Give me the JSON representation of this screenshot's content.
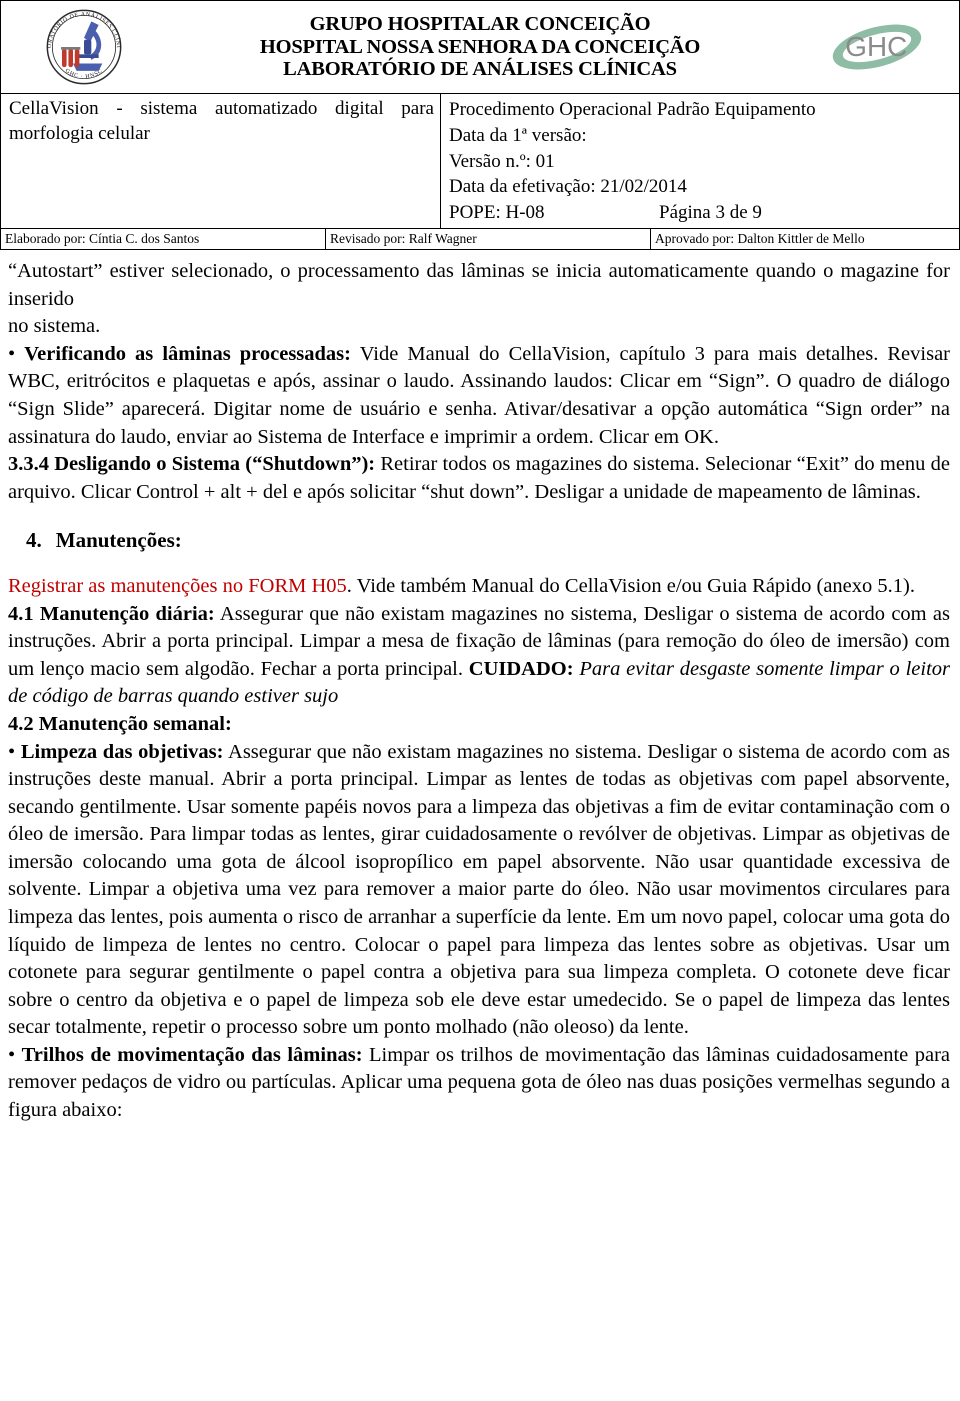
{
  "header": {
    "left_logo": {
      "name": "laboratory-seal-logo",
      "ring_text": "LABORATÓRIO DE ANÁLISES CLÍNICAS",
      "bottom_text": "GHC - HNSC"
    },
    "right_logo": {
      "name": "ghc-logo",
      "text": "GHC"
    },
    "org_lines": [
      "GRUPO HOSPITALAR CONCEIÇÃO",
      "HOSPITAL NOSSA SENHORA DA CONCEIÇÃO",
      "LABORATÓRIO DE ANÁLISES CLÍNICAS"
    ]
  },
  "doc_info": {
    "equipment_title": "CellaVision - sistema automatizado digital para morfologia celular",
    "procedure_title": "Procedimento Operacional Padrão Equipamento",
    "first_version_label": "Data da 1ª versão:",
    "version": "Versão n.º: 01",
    "effective_date": "Data da efetivação: 21/02/2014",
    "pope": "POPE: H-08",
    "page": "Página 3 de 9"
  },
  "signatures": {
    "elaborated_by": "Elaborado por: Cíntia C. dos Santos",
    "revised_by": "Revisado por: Ralf Wagner",
    "approved_by": "Aprovado por: Dalton Kittler de Mello"
  },
  "body": {
    "para_autostart": "“Autostart” estiver selecionado, o processamento das lâminas se inicia automaticamente quando o magazine for inserido",
    "para_no_sistema": "no sistema.",
    "verificando_bullet": "• ",
    "verificando_label": "Verificando as lâminas processadas:",
    "verificando_text": " Vide Manual do CellaVision, capítulo 3 para mais detalhes. Revisar WBC, eritrócitos e plaquetas e após, assinar o laudo. Assinando laudos: Clicar em “Sign”. O quadro de diálogo “Sign Slide” aparecerá. Digitar nome de usuário e senha. Ativar/desativar a opção automática “Sign order” na assinatura do laudo, enviar ao Sistema de Interface e imprimir a ordem. Clicar em OK.",
    "shutdown_label": "3.3.4 Desligando o Sistema (“Shutdown”):",
    "shutdown_text": " Retirar todos os magazines do sistema. Selecionar “Exit” do menu de arquivo. Clicar Control + alt + del e após solicitar “shut down”. Desligar a unidade de mapeamento de lâminas.",
    "manutencoes_number": "4.",
    "manutencoes_title": "Manutenções:",
    "registrar_red": "Registrar as manutenções no FORM H05",
    "registrar_rest": ". Vide também Manual do CellaVision e/ou Guia Rápido (anexo 5.1).",
    "diaria_label": "4.1 Manutenção diária:",
    "diaria_text": " Assegurar que não existam magazines no sistema, Desligar o sistema de acordo com as instruções. Abrir a porta principal. Limpar a mesa de fixação de lâminas (para remoção do óleo de imersão) com um lenço macio sem algodão. Fechar a porta principal. ",
    "cuidado_label": "CUIDADO:",
    "cuidado_text": " Para evitar desgaste somente limpar o leitor de código de barras quando estiver sujo",
    "semanal_label": "4.2 Manutenção semanal:",
    "limpeza_bullet": "• ",
    "limpeza_label": "Limpeza das objetivas:",
    "limpeza_text": " Assegurar que não existam magazines no sistema. Desligar o sistema de acordo com as instruções deste manual. Abrir a porta principal. Limpar as lentes de todas as objetivas com papel absorvente, secando gentilmente. Usar somente papéis novos para a limpeza das objetivas a fim de evitar contaminação com o óleo de imersão. Para limpar todas as lentes, girar cuidadosamente o revólver de objetivas. Limpar as objetivas de imersão colocando uma gota de álcool isopropílico em papel absorvente. Não usar quantidade excessiva de solvente. Limpar a objetiva uma vez para remover a maior parte do óleo. Não usar movimentos circulares para limpeza das lentes, pois aumenta o risco de arranhar a superfície da lente. Em um novo papel, colocar uma gota do líquido de limpeza de lentes no centro. Colocar o papel para limpeza das lentes sobre as objetivas. Usar um cotonete para segurar gentilmente o papel contra a objetiva para sua limpeza completa. O cotonete deve ficar sobre o centro da objetiva e o papel de limpeza sob ele deve estar umedecido. Se o papel de limpeza das lentes secar totalmente, repetir o processo sobre um ponto molhado (não oleoso) da lente.",
    "trilhos_bullet": "• ",
    "trilhos_label": "Trilhos de movimentação das lâminas:",
    "trilhos_text": " Limpar os trilhos de movimentação das lâminas cuidadosamente para remover pedaços de vidro ou partículas. Aplicar uma pequena gota de óleo nas duas posições vermelhas segundo a figura abaixo:"
  },
  "colors": {
    "red_accent": "#C00000",
    "logo_green": "#8FBCA5",
    "logo_blue": "#3B4C9B",
    "border": "#000000"
  }
}
